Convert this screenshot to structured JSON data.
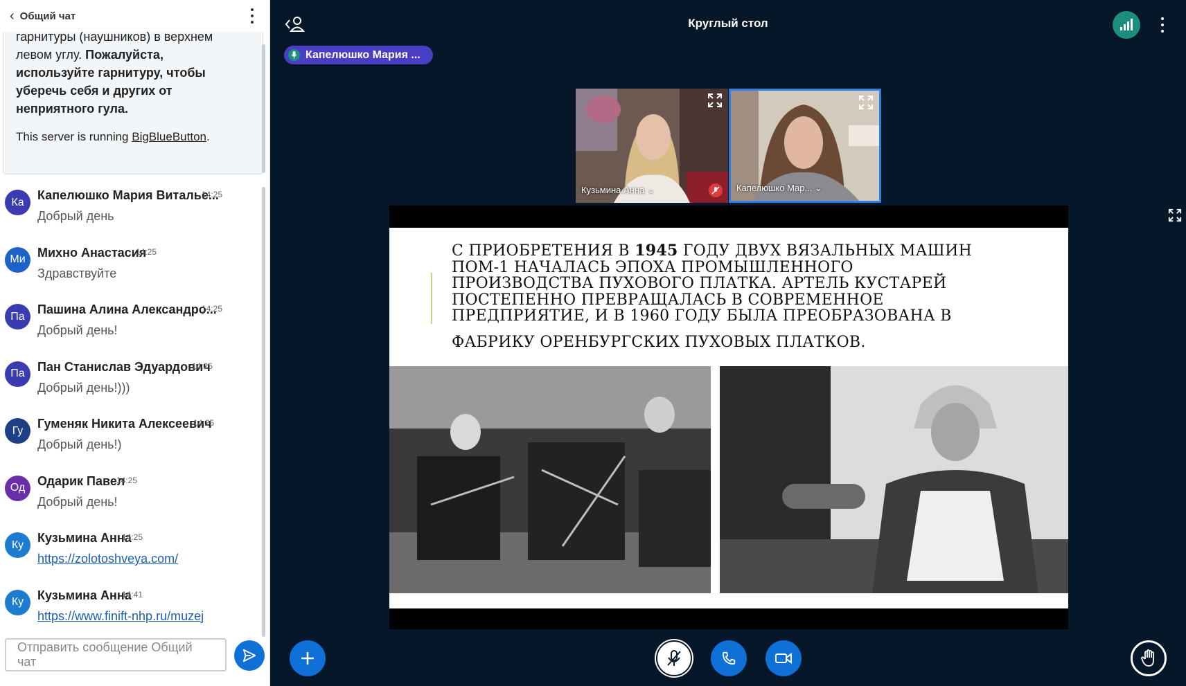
{
  "chat": {
    "title": "Общий чат",
    "welcome": {
      "line1": "гарнитуры (наушников) в верхнем",
      "line2_plain": "левом углу. ",
      "line2_bold": "Пожалуйста,",
      "line3": "используйте гарнитуру, чтобы",
      "line4": "уберечь себя и других от",
      "line5": "неприятного гула.",
      "server_prefix": "This server is running ",
      "server_link": "BigBlueButton",
      "server_suffix": "."
    },
    "messages": [
      {
        "initials": "Ка",
        "color": "#3a3bb0",
        "name": "Капелюшко Мария Виталье...",
        "time": "14:25",
        "text": "Добрый день",
        "link": false
      },
      {
        "initials": "Ми",
        "color": "#1d62c7",
        "name": "Михно Анастасия",
        "time": "14:25",
        "text": "Здравствуйте",
        "link": false
      },
      {
        "initials": "Па",
        "color": "#3a3bb0",
        "name": "Пашина Алина Александро...",
        "time": "14:25",
        "text": "Добрый день!",
        "link": false
      },
      {
        "initials": "Па",
        "color": "#3a3bb0",
        "name": "Пан Станислав Эдуардович",
        "time": "14:25",
        "text": "Добрый день!)))",
        "link": false
      },
      {
        "initials": "Гу",
        "color": "#1e3f86",
        "name": "Гуменяк Никита Алексеевич",
        "time": "14:25",
        "text": "Добрый день!)",
        "link": false
      },
      {
        "initials": "Од",
        "color": "#6a2ea8",
        "name": "Одарик Павел",
        "time": "14:25",
        "text": "Добрый день!",
        "link": false
      },
      {
        "initials": "Ку",
        "color": "#1d7bd0",
        "name": "Кузьмина Анна",
        "time": "14:25",
        "text": "https://zolotoshveya.com/",
        "link": true
      },
      {
        "initials": "Ку",
        "color": "#1d7bd0",
        "name": "Кузьмина Анна",
        "time": "14:41",
        "text": "https://www.finift-nhp.ru/muzej",
        "link": true
      }
    ],
    "input_placeholder": "Отправить сообщение Общий чат"
  },
  "meeting": {
    "title": "Круглый стол",
    "talking": "Капелюшко Мария ...",
    "cams": [
      {
        "label": "Кузьмина Анна ⌄"
      },
      {
        "label": "Капелюшко Мар... ⌄"
      }
    ]
  },
  "slide": {
    "line1_a": "С приобретения в ",
    "line1_year": "1945",
    "line1_b": " году двух вязальных машин",
    "line2": "ПОМ-1 началась эпоха промышленного",
    "line3": "производства пухового платка. Артель кустарей",
    "line4": "постепенно превращалась в современное",
    "line5": "предприятие, и в 1960 году была преобразована в",
    "line6": "фабрику оренбургских пуховых платков."
  },
  "icons": {
    "back": "chevron-left-icon",
    "menu": "more-vertical-icon",
    "send": "send-icon",
    "user": "user-list-icon",
    "signal": "connection-status-icon",
    "plus": "plus-icon",
    "mic": "mic-icon",
    "phone": "phone-icon",
    "video": "video-icon",
    "hand": "raise-hand-icon",
    "expand": "fullscreen-icon"
  }
}
